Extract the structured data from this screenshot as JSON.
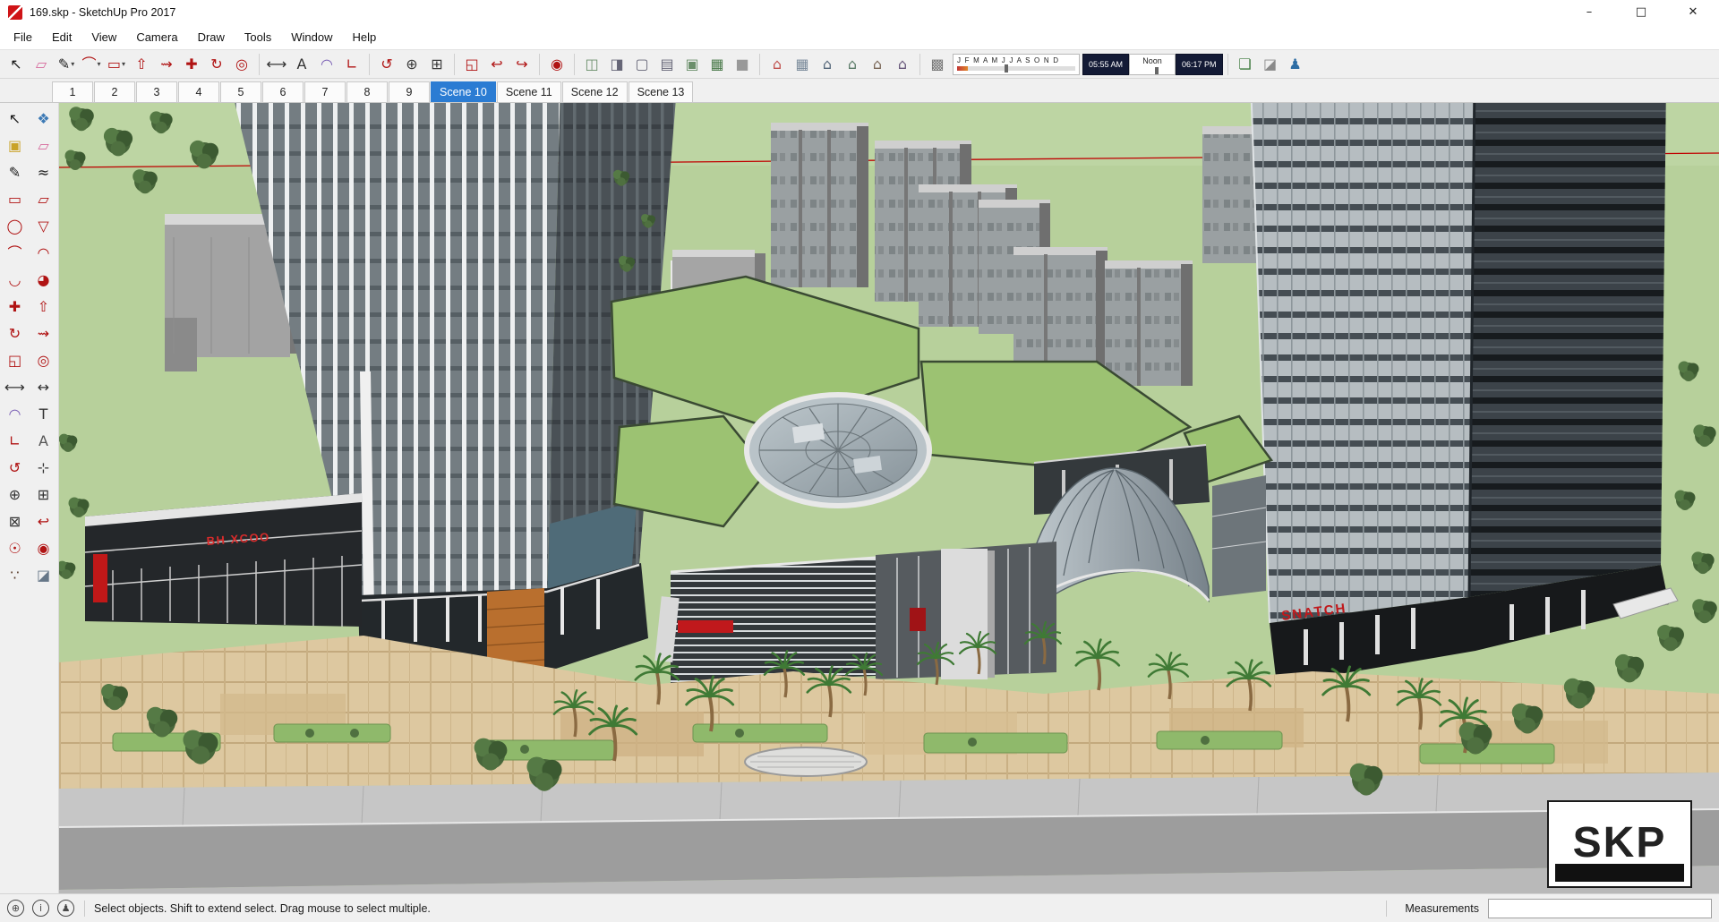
{
  "window": {
    "title": "169.skp - SketchUp Pro 2017",
    "controls": [
      {
        "name": "minimize",
        "glyph": "–"
      },
      {
        "name": "maximize-restore",
        "glyph": "□"
      },
      {
        "name": "close",
        "glyph": "✕"
      }
    ]
  },
  "menu": {
    "items": [
      "File",
      "Edit",
      "View",
      "Camera",
      "Draw",
      "Tools",
      "Window",
      "Help"
    ]
  },
  "toolbar": {
    "main_icons": [
      {
        "name": "select",
        "glyph": "↖",
        "color": "#1a1a1a"
      },
      {
        "name": "eraser",
        "glyph": "▱",
        "color": "#d66a9c"
      },
      {
        "name": "line",
        "glyph": "✎",
        "color": "#1a1a1a",
        "dd": true
      },
      {
        "name": "arc",
        "glyph": "⌒",
        "color": "#b01313",
        "dd": true
      },
      {
        "name": "shapes",
        "glyph": "▭",
        "color": "#b01313",
        "dd": true
      },
      {
        "name": "push-pull",
        "glyph": "⇧",
        "color": "#b01313"
      },
      {
        "name": "follow-me",
        "glyph": "⇝",
        "color": "#b01313"
      },
      {
        "name": "move",
        "glyph": "✚",
        "color": "#b01313"
      },
      {
        "name": "rotate",
        "glyph": "↻",
        "color": "#b01313"
      },
      {
        "name": "offset",
        "glyph": "◎",
        "color": "#b01313"
      },
      {
        "sep": true
      },
      {
        "name": "tape-measure",
        "glyph": "⟷",
        "color": "#333333"
      },
      {
        "name": "text",
        "glyph": "A",
        "color": "#333333"
      },
      {
        "name": "protractor",
        "glyph": "◠",
        "color": "#7a5fb5"
      },
      {
        "name": "axes",
        "glyph": "∟",
        "color": "#b01313"
      },
      {
        "sep": true
      },
      {
        "name": "orbit",
        "glyph": "↺",
        "color": "#b01313"
      },
      {
        "name": "zoom",
        "glyph": "⊕",
        "color": "#3a3a3a"
      },
      {
        "name": "zoom-window",
        "glyph": "⊞",
        "color": "#3a3a3a"
      },
      {
        "sep": true
      },
      {
        "name": "zoom-extents",
        "glyph": "◱",
        "color": "#b01313"
      },
      {
        "name": "previous-view",
        "glyph": "↩",
        "color": "#b01313"
      },
      {
        "name": "next-view",
        "glyph": "↪",
        "color": "#b01313"
      },
      {
        "sep": true
      },
      {
        "name": "look-around",
        "glyph": "◉",
        "color": "#b01313"
      },
      {
        "sep": true
      },
      {
        "name": "x-ray",
        "glyph": "◫",
        "color": "#6b8f6b"
      },
      {
        "name": "back-edges",
        "glyph": "◨",
        "color": "#666677"
      },
      {
        "name": "wireframe",
        "glyph": "▢",
        "color": "#666677"
      },
      {
        "name": "hidden-line",
        "glyph": "▤",
        "color": "#666677"
      },
      {
        "name": "shaded",
        "glyph": "▣",
        "color": "#6b8f6b"
      },
      {
        "name": "shaded-with-textures",
        "glyph": "▦",
        "color": "#4a7a4a"
      },
      {
        "name": "monochrome",
        "glyph": "■",
        "color": "#999999"
      },
      {
        "sep": true
      },
      {
        "name": "view-iso",
        "glyph": "⌂",
        "color": "#c0504d"
      },
      {
        "name": "view-top",
        "glyph": "▦",
        "color": "#7a8a9a"
      },
      {
        "name": "view-front",
        "glyph": "⌂",
        "color": "#55677a"
      },
      {
        "name": "view-right",
        "glyph": "⌂",
        "color": "#5a7a67"
      },
      {
        "name": "view-back",
        "glyph": "⌂",
        "color": "#7a6757"
      },
      {
        "name": "view-left",
        "glyph": "⌂",
        "color": "#67577a"
      },
      {
        "sep": true
      },
      {
        "name": "shadows-toggle",
        "glyph": "▩",
        "color": "#777777"
      }
    ],
    "shadow": {
      "months": "J F M A M J J A S O N D",
      "start": "05:55 AM",
      "noon": "Noon",
      "end": "06:17 PM"
    },
    "right_icons": [
      {
        "name": "add-location",
        "glyph": "❏",
        "color": "#3d7a3d"
      },
      {
        "name": "label",
        "glyph": "◪",
        "color": "#8a8a8a"
      },
      {
        "name": "share-model",
        "glyph": "♟",
        "color": "#2e6da4"
      }
    ]
  },
  "scene_tabs": [
    {
      "label": "1"
    },
    {
      "label": "2"
    },
    {
      "label": "3"
    },
    {
      "label": "4"
    },
    {
      "label": "5"
    },
    {
      "label": "6"
    },
    {
      "label": "7"
    },
    {
      "label": "8"
    },
    {
      "label": "9"
    },
    {
      "label": "Scene 10",
      "active": true
    },
    {
      "label": "Scene 11"
    },
    {
      "label": "Scene 12"
    },
    {
      "label": "Scene 13"
    }
  ],
  "left_toolbar": [
    {
      "name": "select",
      "glyph": "↖",
      "color": "#1a1a1a"
    },
    {
      "name": "make-component",
      "glyph": "❖",
      "color": "#3d7ab5"
    },
    {
      "name": "paint-bucket",
      "glyph": "▣",
      "color": "#c9a227"
    },
    {
      "name": "eraser",
      "glyph": "▱",
      "color": "#d66a9c"
    },
    {
      "name": "line",
      "glyph": "✎",
      "color": "#1a1a1a"
    },
    {
      "name": "freehand",
      "glyph": "≈",
      "color": "#1a1a1a"
    },
    {
      "name": "rectangle",
      "glyph": "▭",
      "color": "#b01313"
    },
    {
      "name": "rotated-rectangle",
      "glyph": "▱",
      "color": "#b01313"
    },
    {
      "name": "circle",
      "glyph": "◯",
      "color": "#b01313"
    },
    {
      "name": "polygon",
      "glyph": "▽",
      "color": "#b01313"
    },
    {
      "name": "arc",
      "glyph": "⌒",
      "color": "#b01313"
    },
    {
      "name": "two-point-arc",
      "glyph": "◠",
      "color": "#b01313"
    },
    {
      "name": "three-point-arc",
      "glyph": "◡",
      "color": "#b01313"
    },
    {
      "name": "pie",
      "glyph": "◕",
      "color": "#b01313"
    },
    {
      "name": "move",
      "glyph": "✚",
      "color": "#b01313"
    },
    {
      "name": "push-pull",
      "glyph": "⇧",
      "color": "#b01313"
    },
    {
      "name": "rotate",
      "glyph": "↻",
      "color": "#b01313"
    },
    {
      "name": "follow-me",
      "glyph": "⇝",
      "color": "#b01313"
    },
    {
      "name": "scale",
      "glyph": "◱",
      "color": "#b01313"
    },
    {
      "name": "offset",
      "glyph": "◎",
      "color": "#b01313"
    },
    {
      "name": "tape-measure",
      "glyph": "⟷",
      "color": "#333333"
    },
    {
      "name": "dimension",
      "glyph": "↔",
      "color": "#333333"
    },
    {
      "name": "protractor",
      "glyph": "◠",
      "color": "#7a5fb5"
    },
    {
      "name": "text",
      "glyph": "T",
      "color": "#333333"
    },
    {
      "name": "axes",
      "glyph": "∟",
      "color": "#b01313"
    },
    {
      "name": "3d-text",
      "glyph": "A",
      "color": "#555555"
    },
    {
      "name": "orbit",
      "glyph": "↺",
      "color": "#b01313"
    },
    {
      "name": "pan",
      "glyph": "⊹",
      "color": "#333333"
    },
    {
      "name": "zoom",
      "glyph": "⊕",
      "color": "#333333"
    },
    {
      "name": "zoom-window",
      "glyph": "⊞",
      "color": "#333333"
    },
    {
      "name": "zoom-extents",
      "glyph": "⊠",
      "color": "#333333"
    },
    {
      "name": "previous",
      "glyph": "↩",
      "color": "#b01313"
    },
    {
      "name": "position-camera",
      "glyph": "☉",
      "color": "#b01313"
    },
    {
      "name": "look-around",
      "glyph": "◉",
      "color": "#b01313"
    },
    {
      "name": "walk",
      "glyph": "∵",
      "color": "#5a3d2b"
    },
    {
      "name": "section-plane",
      "glyph": "◪",
      "color": "#667788"
    }
  ],
  "viewport": {
    "watermark": "SKP",
    "sign_left": "BH XCOO",
    "sign_right": "SNATCH"
  },
  "statusbar": {
    "icons": [
      {
        "name": "geolocate",
        "glyph": "⊕"
      },
      {
        "name": "credits",
        "glyph": "i"
      },
      {
        "name": "sign-in",
        "glyph": "♟"
      }
    ],
    "hint": "Select objects. Shift to extend select. Drag mouse to select multiple.",
    "measurements_label": "Measurements",
    "measurements_value": ""
  }
}
